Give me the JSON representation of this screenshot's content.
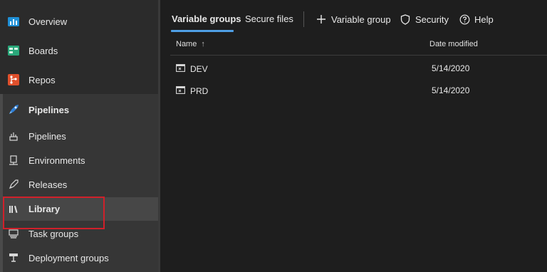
{
  "sidebar": {
    "items": [
      {
        "label": "Overview",
        "icon": "overview-icon"
      },
      {
        "label": "Boards",
        "icon": "boards-icon"
      },
      {
        "label": "Repos",
        "icon": "repos-icon"
      },
      {
        "label": "Pipelines",
        "icon": "pipelines-rocket-icon"
      },
      {
        "label": "Pipelines",
        "icon": "pipelines-icon"
      },
      {
        "label": "Environments",
        "icon": "environments-icon"
      },
      {
        "label": "Releases",
        "icon": "releases-icon"
      },
      {
        "label": "Library",
        "icon": "library-icon"
      },
      {
        "label": "Task groups",
        "icon": "task-groups-icon"
      },
      {
        "label": "Deployment groups",
        "icon": "deployment-groups-icon"
      }
    ]
  },
  "tabs": {
    "variable_groups": "Variable groups",
    "secure_files": "Secure files"
  },
  "toolbar": {
    "add_variable_group": "Variable group",
    "security": "Security",
    "help": "Help"
  },
  "grid": {
    "columns": {
      "name": "Name",
      "sort_arrow": "↑",
      "date_modified": "Date modified"
    },
    "rows": [
      {
        "name": "DEV",
        "date": "5/14/2020"
      },
      {
        "name": "PRD",
        "date": "5/14/2020"
      }
    ]
  },
  "colors": {
    "accent": "#4f9fe6",
    "highlight": "#d0202a"
  }
}
